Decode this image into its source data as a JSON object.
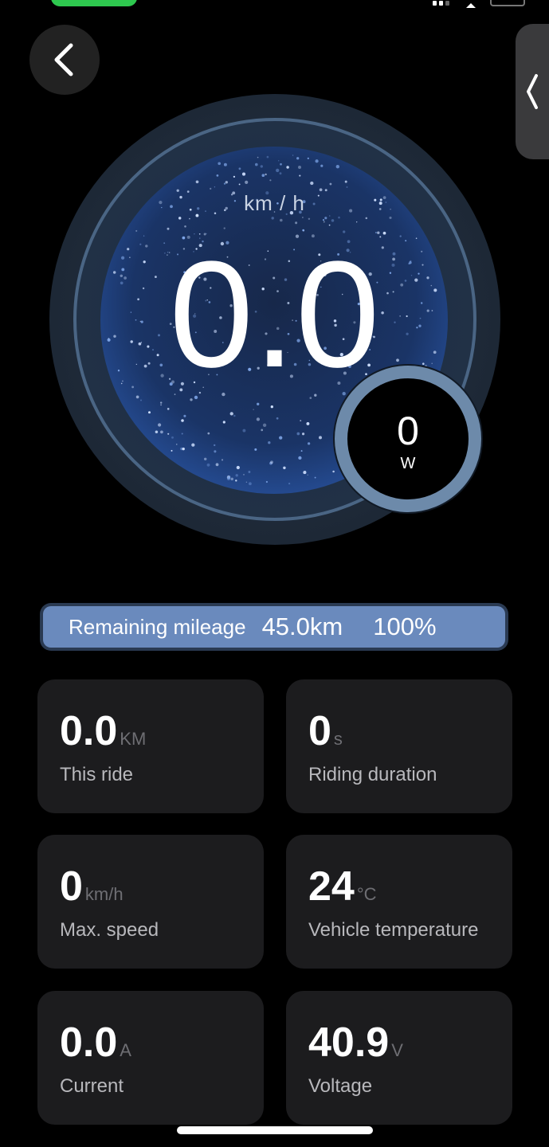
{
  "header": {
    "back_icon": "chevron-left-icon",
    "side_tab_icon": "chevron-left-icon"
  },
  "gauge": {
    "speed_unit": "km / h",
    "speed_value": "0.0",
    "power_value": "0",
    "power_unit": "W"
  },
  "mileage": {
    "label": "Remaining mileage",
    "distance": "45.0km",
    "percent": "100%",
    "level": 1.0
  },
  "stats": [
    {
      "value": "0.0",
      "unit": "KM",
      "label": "This ride"
    },
    {
      "value": "0",
      "unit": "s",
      "label": "Riding duration"
    },
    {
      "value": "0",
      "unit": "km/h",
      "label": "Max. speed"
    },
    {
      "value": "24",
      "unit": "°C",
      "label": "Vehicle temperature"
    },
    {
      "value": "0.0",
      "unit": "A",
      "label": "Current"
    },
    {
      "value": "40.9",
      "unit": "V",
      "label": "Voltage"
    }
  ],
  "colors": {
    "background": "#000000",
    "card": "#1c1c1e",
    "accent_blue": "#6a8abd",
    "power_ring": "#6d8aaa"
  }
}
